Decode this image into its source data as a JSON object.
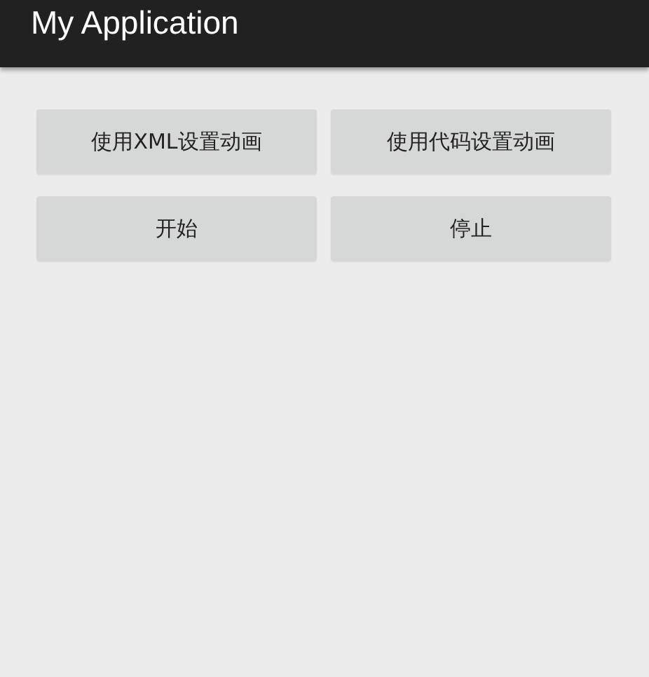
{
  "app_bar": {
    "title": "My Application"
  },
  "buttons": [
    {
      "label": "使用XML设置动画"
    },
    {
      "label": "使用代码设置动画"
    },
    {
      "label": "开始"
    },
    {
      "label": "停止"
    }
  ]
}
